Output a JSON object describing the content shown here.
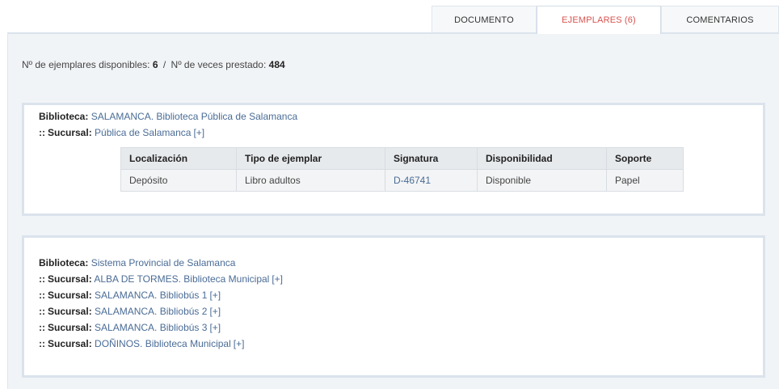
{
  "tabs": {
    "documento": "DOCUMENTO",
    "ejemplares": "EJEMPLARES",
    "ejemplares_count": "(6)",
    "comentarios": "COMENTARIOS"
  },
  "summary": {
    "available_label": "Nº de ejemplares disponibles:",
    "available_value": "6",
    "separator": "/",
    "loans_label": "Nº de veces prestado:",
    "loans_value": "484"
  },
  "labels": {
    "biblioteca": "Biblioteca:",
    "sucursal": "Sucursal:",
    "bullet": "::",
    "expand": "[+]"
  },
  "libraries": [
    {
      "name": "SALAMANCA. Biblioteca Pública de Salamanca",
      "branches": [
        "Pública de Salamanca"
      ],
      "table": {
        "headers": [
          "Localización",
          "Tipo de ejemplar",
          "Signatura",
          "Disponibilidad",
          "Soporte"
        ],
        "rows": [
          [
            "Depósito",
            "Libro adultos",
            "D-46741",
            "Disponible",
            "Papel"
          ]
        ]
      }
    },
    {
      "name": "Sistema Provincial de Salamanca",
      "branches": [
        "ALBA DE TORMES. Biblioteca Municipal",
        "SALAMANCA. Bibliobús 1",
        "SALAMANCA. Bibliobús 2",
        "SALAMANCA. Bibliobús 3",
        "DOÑINOS. Biblioteca Municipal"
      ]
    }
  ],
  "colors": {
    "active_tab": "#d9534f",
    "link": "#4a6c96",
    "panel_bg": "#f1f4f7",
    "table_header": "#e7eaed"
  }
}
